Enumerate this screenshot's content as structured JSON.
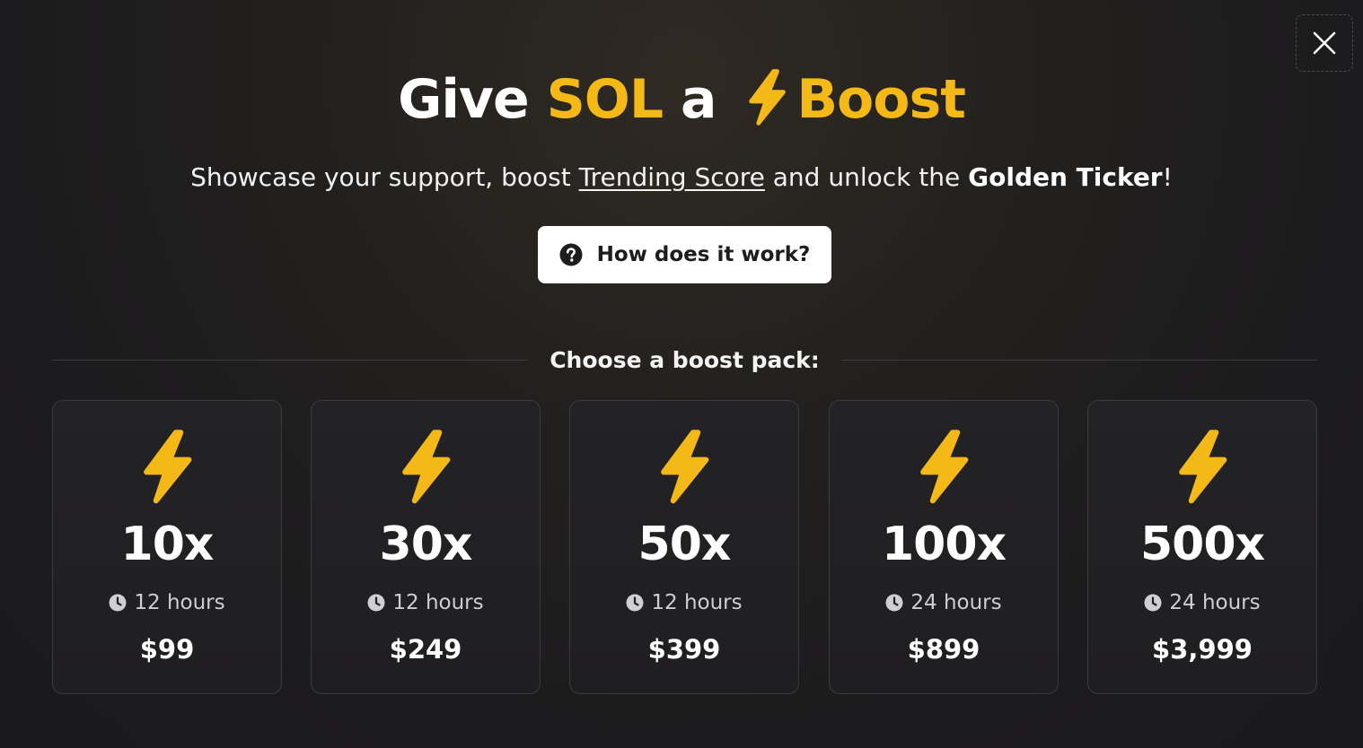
{
  "title": {
    "part1": "Give",
    "token": "SOL",
    "part2": "a",
    "boost": "Boost"
  },
  "subtitle": {
    "before": "Showcase your support, boost ",
    "link": "Trending Score",
    "middle": " and unlock the ",
    "bold": "Golden Ticker",
    "after": "!"
  },
  "how_button": {
    "label": "How does it work?",
    "icon": "question-circle-icon"
  },
  "section_label": "Choose a boost pack:",
  "packs": [
    {
      "multiplier": "10x",
      "duration": "12 hours",
      "price": "$99"
    },
    {
      "multiplier": "30x",
      "duration": "12 hours",
      "price": "$249"
    },
    {
      "multiplier": "50x",
      "duration": "12 hours",
      "price": "$399"
    },
    {
      "multiplier": "100x",
      "duration": "24 hours",
      "price": "$899"
    },
    {
      "multiplier": "500x",
      "duration": "24 hours",
      "price": "$3,999"
    }
  ],
  "colors": {
    "accent": "#f4b916",
    "background": "#1c1b1d",
    "card_border": "#3c3a3e",
    "button_bg": "#ffffff"
  },
  "icons": {
    "close": "close-icon",
    "bolt": "lightning-bolt-icon",
    "clock": "clock-icon"
  }
}
